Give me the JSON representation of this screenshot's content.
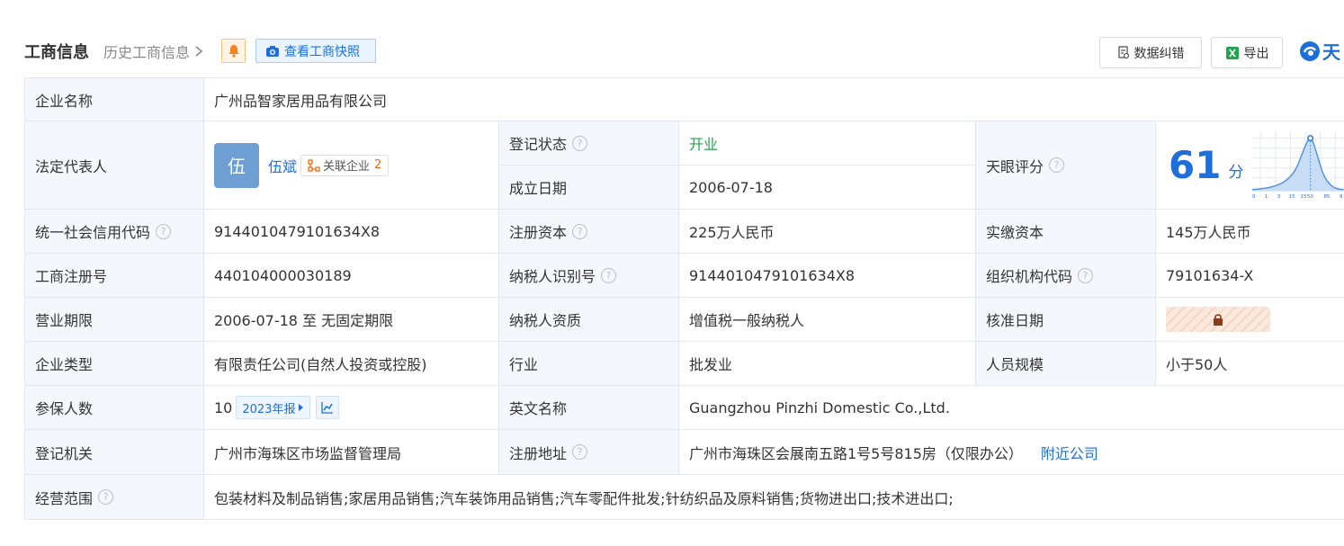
{
  "header": {
    "title": "工商信息",
    "history_link": "历史工商信息",
    "snapshot_button": "查看工商快照",
    "correct_button": "数据纠错",
    "export_button": "导出",
    "logo_text": "天"
  },
  "icons": {
    "bell": "bell-icon",
    "camera": "camera-icon",
    "doc": "document-icon",
    "excel": "excel-icon",
    "chevron": "chevron-right-icon",
    "help": "question-circle-icon",
    "lock": "lock-icon",
    "trend": "trend-chart-icon"
  },
  "colors": {
    "accent": "#1e6fd9",
    "status_open": "#21a54e",
    "label_bg": "#f4f8fd",
    "notice": "#f06a11"
  },
  "help_glyph": "?",
  "company": {
    "name_label": "企业名称",
    "name": "广州品智家居用品有限公司",
    "legal_rep_label": "法定代表人",
    "legal_rep_avatar": "伍",
    "legal_rep_name": "伍斌",
    "related_label": "关联企业",
    "related_count": "2",
    "reg_status_label": "登记状态",
    "reg_status": "开业",
    "founded_label": "成立日期",
    "founded": "2006-07-18",
    "score_label": "天眼评分",
    "score": "61",
    "score_unit": "分",
    "score_axis": [
      "0",
      "1",
      "3",
      "15",
      "15",
      "50",
      "85",
      "9"
    ],
    "credit_code_label": "统一社会信用代码",
    "credit_code": "9144010479101634X8",
    "reg_capital_label": "注册资本",
    "reg_capital": "225万人民币",
    "paid_capital_label": "实缴资本",
    "paid_capital": "145万人民币",
    "reg_no_label": "工商注册号",
    "reg_no": "440104000030189",
    "taxpayer_id_label": "纳税人识别号",
    "taxpayer_id": "9144010479101634X8",
    "org_code_label": "组织机构代码",
    "org_code": "79101634-X",
    "term_label": "营业期限",
    "term": "2006-07-18 至 无固定期限",
    "tax_qual_label": "纳税人资质",
    "tax_qual": "增值税一般纳税人",
    "approval_label": "核准日期",
    "type_label": "企业类型",
    "type": "有限责任公司(自然人投资或控股)",
    "industry_label": "行业",
    "industry": "批发业",
    "staff_label": "人员规模",
    "staff": "小于50人",
    "insured_label": "参保人数",
    "insured": "10",
    "insured_year": "2023年报",
    "en_name_label": "英文名称",
    "en_name": "Guangzhou Pinzhi Domestic Co.,Ltd.",
    "authority_label": "登记机关",
    "authority": "广州市海珠区市场监督管理局",
    "address_label": "注册地址",
    "address": "广州市海珠区会展南五路1号5号815房（仅限办公）",
    "nearby_link": "附近公司",
    "scope_label": "经营范围",
    "scope": "包装材料及制品销售;家居用品销售;汽车装饰用品销售;汽车零配件批发;针纺织品及原料销售;货物进出口;技术进出口;"
  }
}
